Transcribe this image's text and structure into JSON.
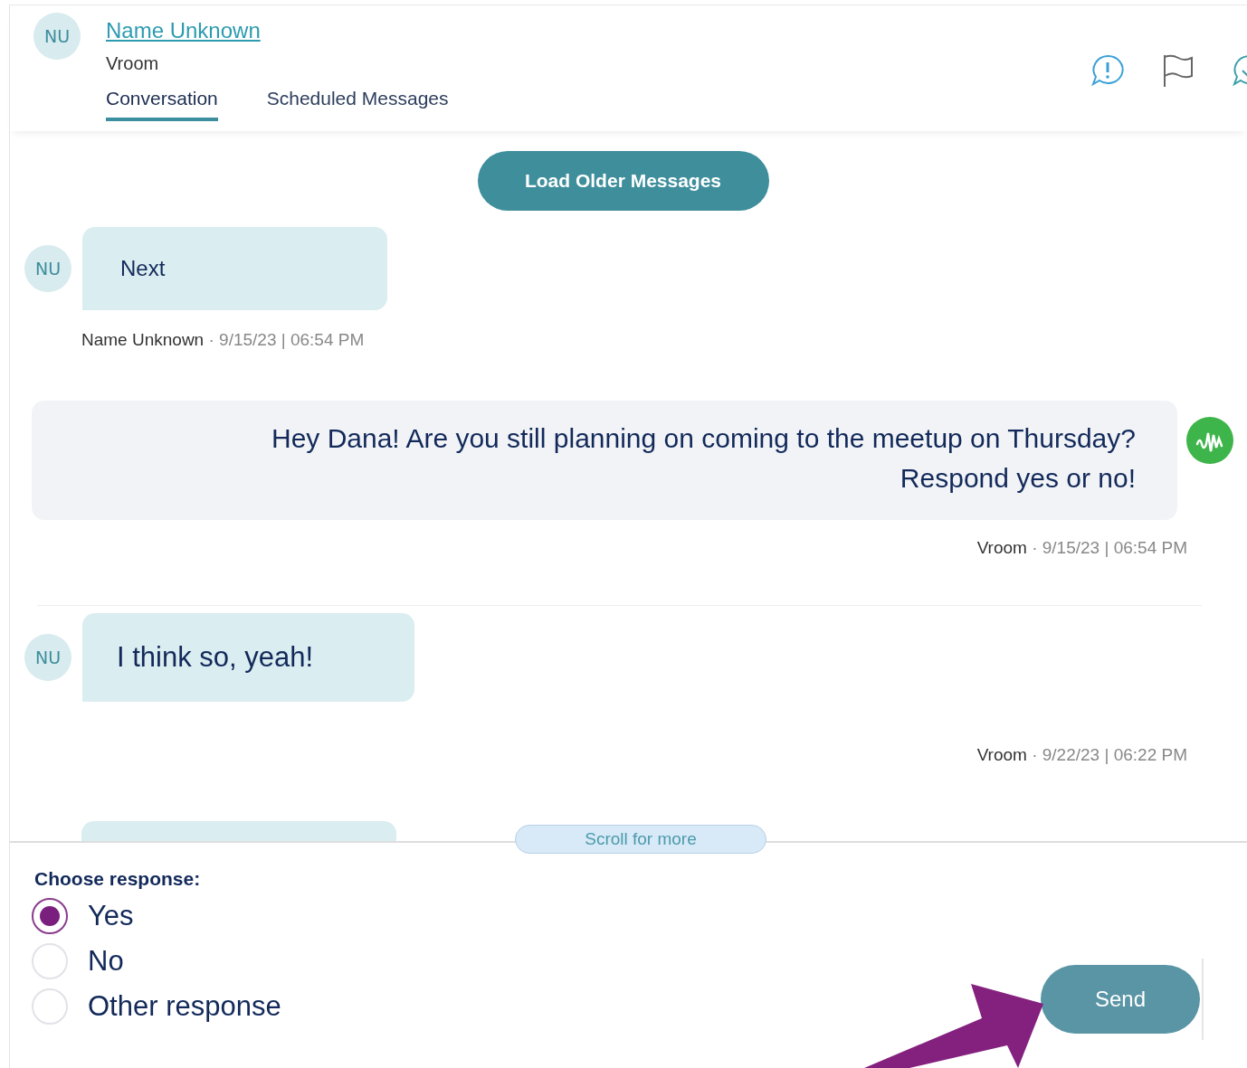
{
  "contact": {
    "initials": "NU",
    "name": "Name Unknown",
    "organization": "Vroom"
  },
  "tabs": [
    {
      "label": "Conversation",
      "selected": true
    },
    {
      "label": "Scheduled Messages",
      "selected": false
    }
  ],
  "load_older": "Load Older Messages",
  "messages": [
    {
      "kind": "incoming",
      "initials": "NU",
      "text": "Next",
      "meta_author": "Name Unknown",
      "meta_date": "· 9/15/23 | 06:54 PM",
      "meta_right": false
    },
    {
      "kind": "outgoing",
      "text": "Hey Dana! Are you still planning on coming to the meetup on Thursday? Respond yes or no!",
      "meta_author": "Vroom",
      "meta_date": "· 9/15/23 | 06:54 PM",
      "meta_right": true
    },
    {
      "kind": "incoming",
      "initials": "NU",
      "text": "I think so, yeah!",
      "meta_author": "Vroom",
      "meta_date": "· 9/22/23 | 06:22 PM",
      "meta_right": true
    }
  ],
  "scroll_hint": "Scroll for more",
  "response": {
    "label": "Choose response:",
    "options": [
      {
        "label": "Yes",
        "selected": true
      },
      {
        "label": "No",
        "selected": false
      },
      {
        "label": "Other response",
        "selected": false
      }
    ]
  },
  "send_button": "Send"
}
